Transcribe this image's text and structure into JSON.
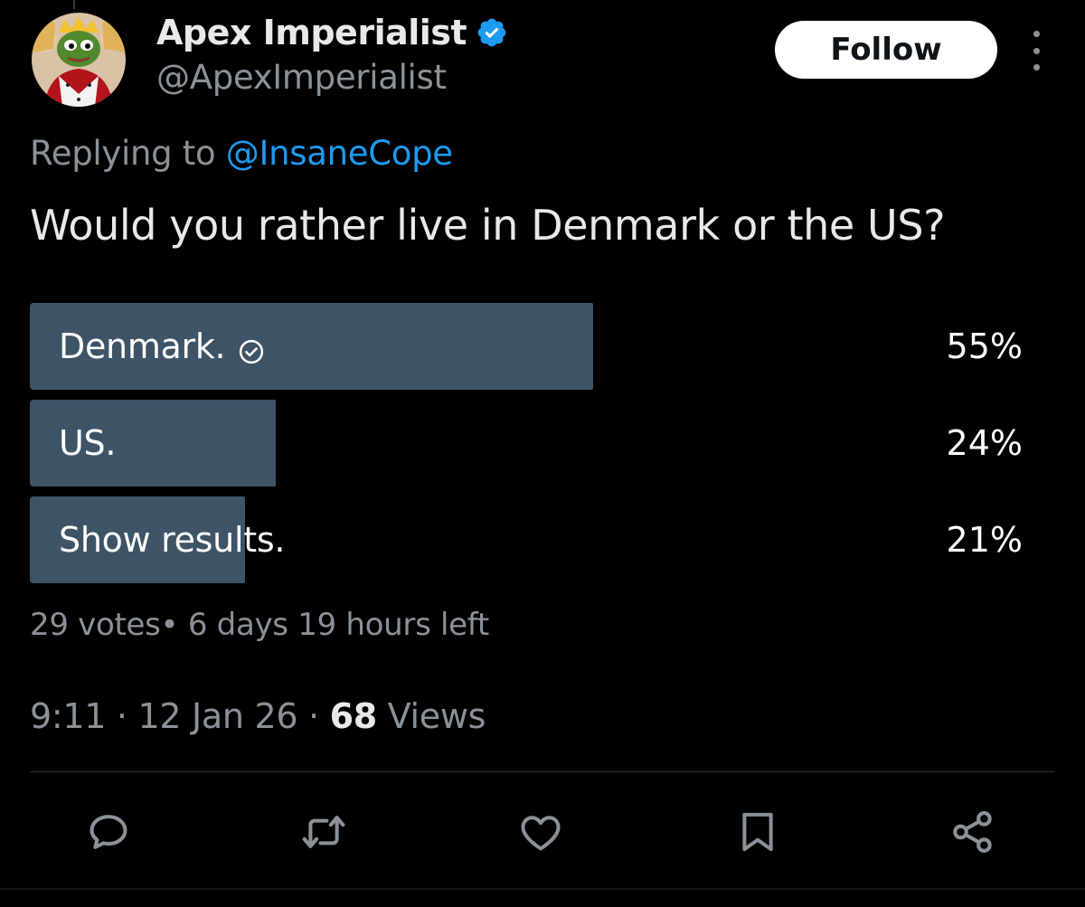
{
  "user": {
    "display_name": "Apex Imperialist",
    "handle": "@ApexImperialist",
    "verified": true,
    "avatar_icon": "king-frog-avatar"
  },
  "header": {
    "follow_label": "Follow",
    "more_icon": "more-vertical-icon"
  },
  "reply": {
    "prefix": "Replying to",
    "mention": "@InsaneCope"
  },
  "tweet": {
    "text": "Would you rather live in Denmark or the US?"
  },
  "poll": {
    "options": [
      {
        "label": "Denmark.",
        "percent": "55%",
        "share": 0.55,
        "winner": true
      },
      {
        "label": "US.",
        "percent": "24%",
        "share": 0.24,
        "winner": false
      },
      {
        "label": "Show results.",
        "percent": "21%",
        "share": 0.21,
        "winner": false
      }
    ],
    "meta": "29 votes• 6 days 19 hours left"
  },
  "timestamp": {
    "time": "9:11",
    "date": "12 Jan 26",
    "views_count": "68",
    "views_label": "Views",
    "separator": "·"
  },
  "actions": [
    "reply-icon",
    "retweet-icon",
    "like-icon",
    "bookmark-icon",
    "share-icon"
  ],
  "colors": {
    "background": "#000000",
    "poll_bar": "#3e5466",
    "link": "#1d9bf0",
    "muted": "#8b9198",
    "verified": "#1d9bf0"
  }
}
